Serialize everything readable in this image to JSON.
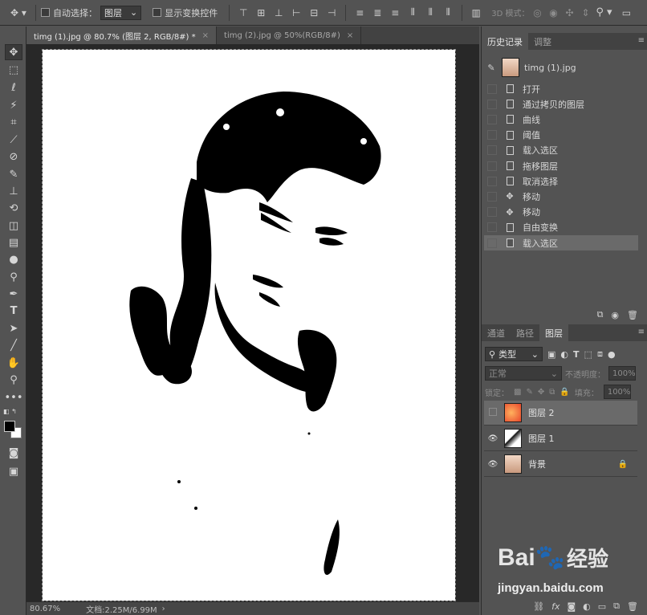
{
  "options_bar": {
    "auto_select_label": "自动选择：",
    "auto_select_value": "图层",
    "show_transform_label": "显示变换控件",
    "mode_3d_label": "3D 模式："
  },
  "tabs": [
    {
      "label": "timg (1).jpg @ 80.7% (图层 2, RGB/8#) *",
      "close": "×"
    },
    {
      "label": "timg (2).jpg @ 50%(RGB/8#)",
      "close": "×"
    }
  ],
  "status": {
    "zoom": "80.67%",
    "doc_info": "文档:2.25M/6.99M"
  },
  "history": {
    "tabs": [
      "历史记录",
      "调整"
    ],
    "snapshot_name": "timg (1).jpg",
    "items": [
      {
        "label": "打开",
        "icon": "doc-icon"
      },
      {
        "label": "通过拷贝的图层",
        "icon": "doc-icon"
      },
      {
        "label": "曲线",
        "icon": "doc-icon"
      },
      {
        "label": "阈值",
        "icon": "doc-icon"
      },
      {
        "label": "载入选区",
        "icon": "doc-icon"
      },
      {
        "label": "拖移图层",
        "icon": "doc-icon"
      },
      {
        "label": "取消选择",
        "icon": "doc-icon"
      },
      {
        "label": "移动",
        "icon": "move-icon"
      },
      {
        "label": "移动",
        "icon": "move-icon"
      },
      {
        "label": "自由变换",
        "icon": "doc-icon"
      },
      {
        "label": "载入选区",
        "icon": "doc-icon",
        "selected": true
      }
    ]
  },
  "layers_panel": {
    "tabs": [
      "通道",
      "路径",
      "图层"
    ],
    "filter_label": "类型",
    "blend_mode": "正常",
    "opacity_label": "不透明度：",
    "opacity_value": "100%",
    "lock_label": "锁定：",
    "fill_label": "填充：",
    "fill_value": "100%",
    "layers": [
      {
        "name": "图层 2",
        "visible": false,
        "selected": true
      },
      {
        "name": "图层 1",
        "visible": true,
        "selected": false
      },
      {
        "name": "背景",
        "visible": true,
        "locked": true
      }
    ]
  },
  "watermark": {
    "brand": "Bai",
    "brand_cn": "经验",
    "url": "jingyan.baidu.com"
  }
}
